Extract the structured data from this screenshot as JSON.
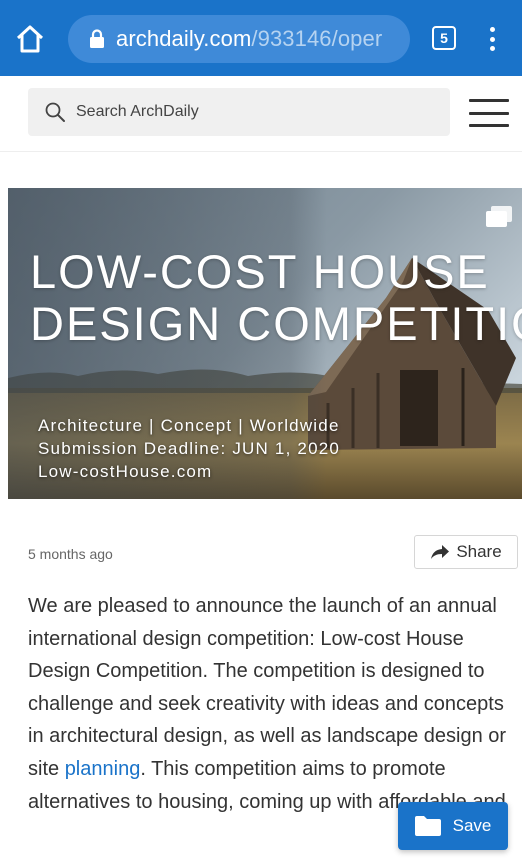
{
  "browser": {
    "url_domain": "archdaily.com",
    "url_path": "/933146/oper",
    "tab_count": "5",
    "icons": [
      "home-icon",
      "lock-icon",
      "tabs-icon",
      "more-vert-icon"
    ]
  },
  "header": {
    "search_placeholder": "Search ArchDaily",
    "icons": [
      "search-icon",
      "hamburger-menu-icon"
    ]
  },
  "hero": {
    "title_line1": "LOW-COST HOUSE",
    "title_line2": "DESIGN COMPETITION",
    "subtitle_line1": "Architecture | Concept | Worldwide",
    "subtitle_line2": "Submission Deadline: JUN 1, 2020",
    "subtitle_line3": "Low-costHouse.com",
    "icon": "gallery-icon"
  },
  "meta": {
    "time_ago": "5 months ago",
    "share_label": "Share"
  },
  "article": {
    "text_before_link": "We are pleased to announce the launch of an annual international design competition: Low-cost House Design Competition. The competition is designed to challenge and seek creativity with ideas and concepts in architectural design, as well as landscape design or site ",
    "link_text": "planning",
    "text_after_link": ". This competition aims to promote alternatives to housing, coming up with affordable and"
  },
  "save": {
    "label": "Save",
    "icon": "folder-icon"
  },
  "colors": {
    "brand_blue": "#1a73c9",
    "url_pill": "#3f8ad8",
    "link": "#1a73c9"
  }
}
